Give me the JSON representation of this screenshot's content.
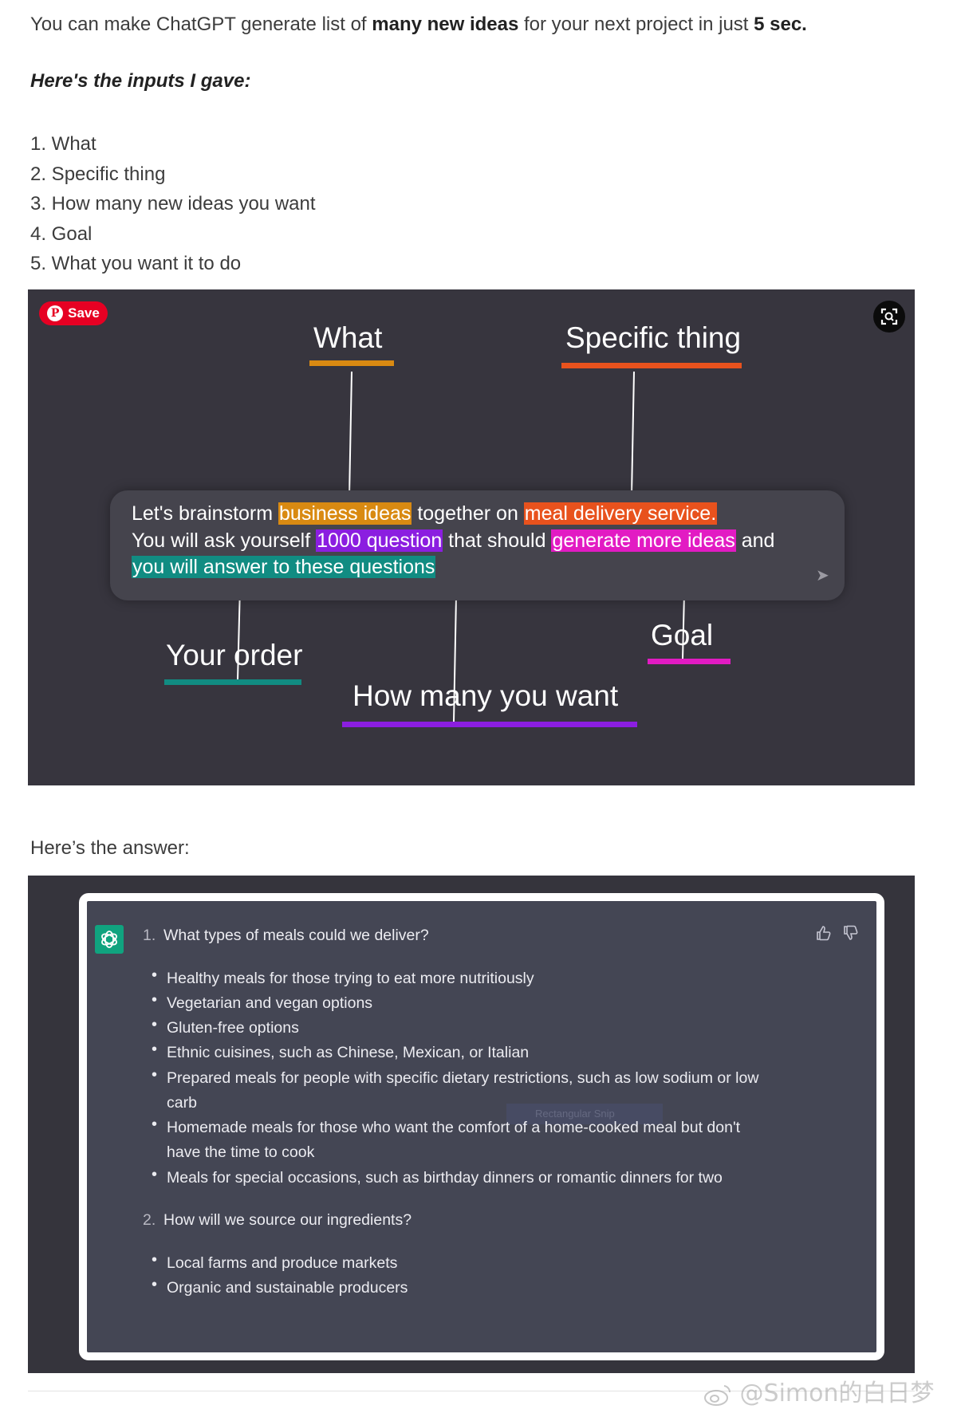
{
  "intro": {
    "pre": "You can make ChatGPT generate list of ",
    "bold1": "many new ideas",
    "mid": " for your next project in just ",
    "bold2": "5 sec."
  },
  "inputs_heading": "Here's the inputs I gave:",
  "inputs": [
    "1. What",
    "2. Specific thing",
    "3. How many new ideas you want",
    "4. Goal",
    "5. What you want it to do"
  ],
  "diagram": {
    "save_label": "Save",
    "pin_glyph": "P",
    "labels": {
      "what": "What",
      "specific": "Specific thing",
      "order": "Your order",
      "goal": "Goal",
      "howmany": "How many you want"
    },
    "prompt": {
      "l1_a": "Let's brainstorm ",
      "l1_hl1": "business ideas",
      "l1_b": " together on ",
      "l1_hl2": "meal delivery service.",
      "l2_a": "You will ask yourself ",
      "l2_hl1": "1000 question",
      "l2_b": " that should ",
      "l2_hl2": "generate more ideas",
      "l2_c": " and",
      "l3_hl": "you will answer to these questions"
    },
    "colors": {
      "what": "#d98a12",
      "specific": "#e8521d",
      "howmany": "#8b1ee0",
      "goal": "#e21bc3",
      "order": "#118c82"
    }
  },
  "answer_heading": "Here’s the answer:",
  "chat": {
    "q1_num": "1.",
    "q1": "What types of meals could we deliver?",
    "bullets": [
      "Healthy meals for those trying to eat more nutritiously",
      "Vegetarian and vegan options",
      "Gluten-free options",
      "Ethnic cuisines, such as Chinese, Mexican, or Italian",
      "Prepared meals for people with specific dietary restrictions, such as low sodium or low",
      "Homemade meals for those who want the comfort of a home-cooked meal but don't",
      "Meals for special occasions, such as birthday dinners or romantic dinners for two"
    ],
    "bullet4_cont": "carb",
    "bullet5_cont": "have the time to cook",
    "snip_text": "Rectangular Snip",
    "q2_num": "2.",
    "q2": "How will we source our ingredients?",
    "bullets2": [
      "Local farms and produce markets",
      "Organic and sustainable producers"
    ]
  },
  "watermark": "@Simon的白日梦"
}
